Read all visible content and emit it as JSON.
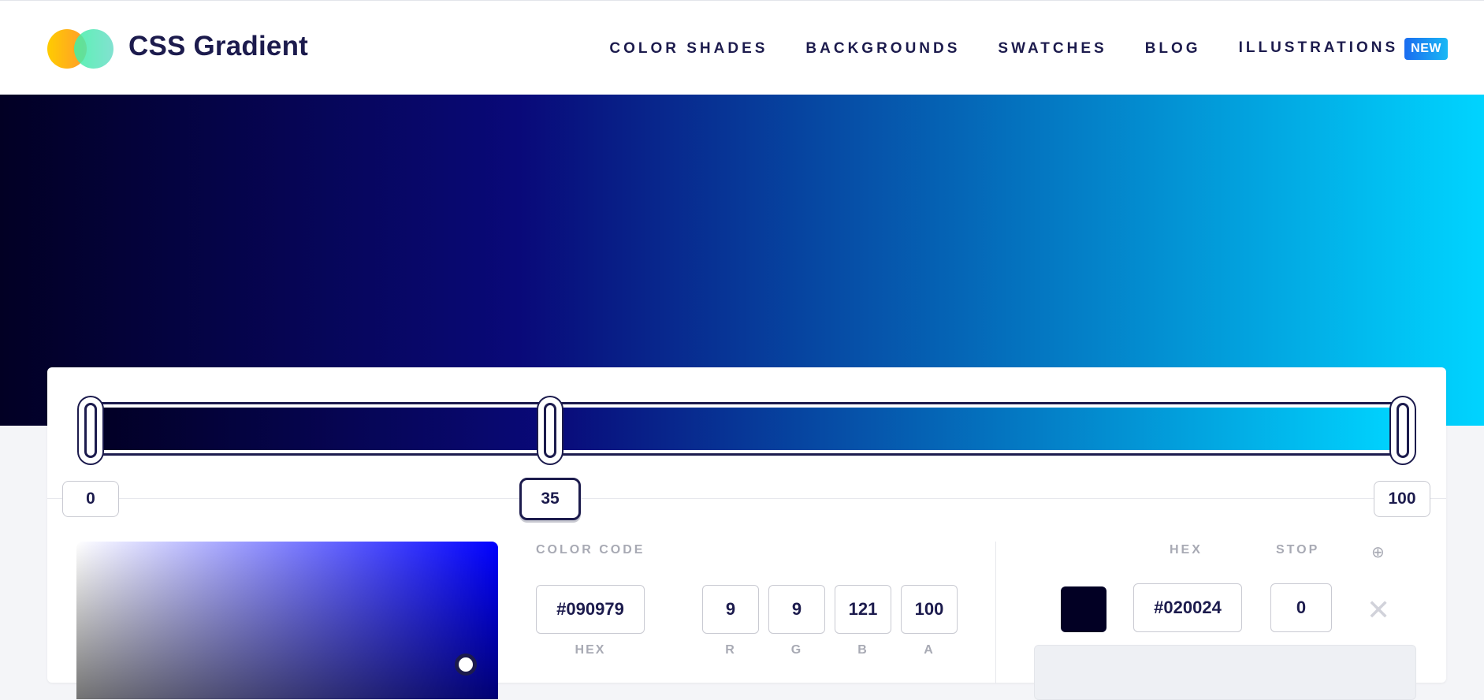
{
  "brand": {
    "name": "CSS Gradient"
  },
  "nav": {
    "items": [
      {
        "label": "COLOR SHADES"
      },
      {
        "label": "BACKGROUNDS"
      },
      {
        "label": "SWATCHES"
      },
      {
        "label": "BLOG"
      },
      {
        "label": "ILLUSTRATIONS"
      }
    ],
    "new_badge": "NEW"
  },
  "gradient": {
    "stops": [
      {
        "color": "#020024",
        "position": 0
      },
      {
        "color": "#090979",
        "position": 35
      },
      {
        "color": "#00d4ff",
        "position": 100
      }
    ],
    "active_stop_index": 1
  },
  "stop_labels": [
    "0",
    "35",
    "100"
  ],
  "editor": {
    "color_code_label": "COLOR CODE",
    "hex_value": "#090979",
    "hex_label": "HEX",
    "rgba": {
      "r": "9",
      "g": "9",
      "b": "121",
      "a": "100",
      "r_label": "R",
      "g_label": "G",
      "b_label": "B",
      "a_label": "A"
    }
  },
  "stops_table": {
    "hex_header": "HEX",
    "stop_header": "STOP",
    "add_icon": "target-icon",
    "rows": [
      {
        "hex": "#020024",
        "stop": "0",
        "swatch": "#020024"
      }
    ],
    "remove_icon": "close-icon",
    "remove_glyph": "✕"
  },
  "colors": {
    "primary": "#1c1b4d",
    "accent_badge": "#1a6cf0"
  }
}
